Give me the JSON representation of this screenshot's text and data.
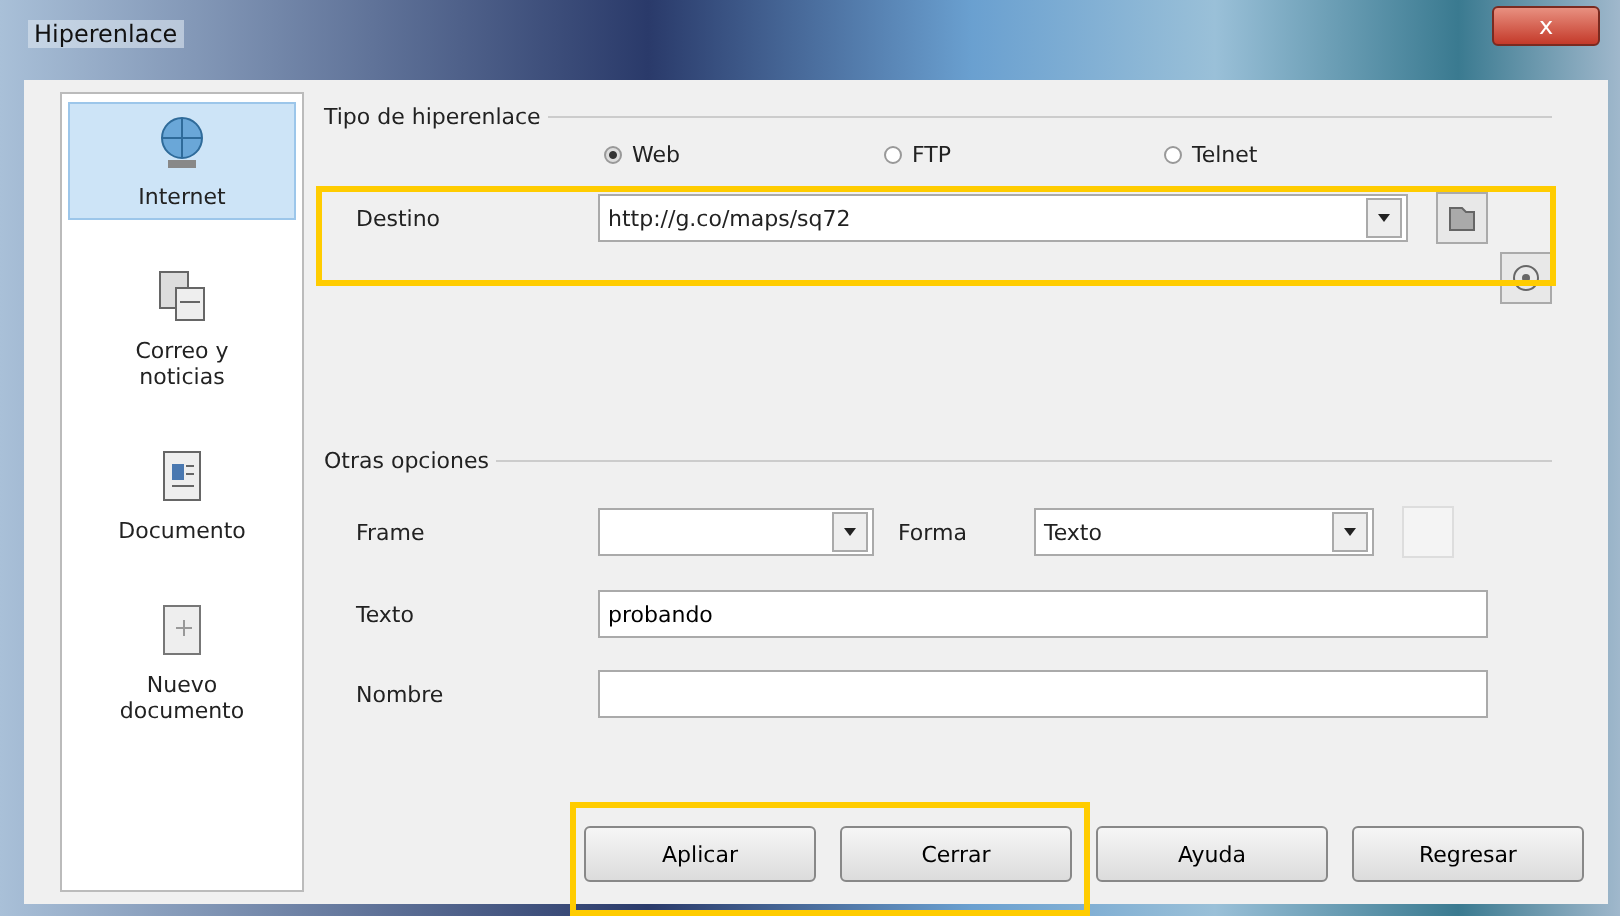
{
  "window": {
    "title": "Hiperenlace",
    "close": "x"
  },
  "sidebar": {
    "items": [
      {
        "label": "Internet",
        "selected": true,
        "kind": "globe"
      },
      {
        "label": "Correo y noticias",
        "selected": false,
        "kind": "mail"
      },
      {
        "label": "Documento",
        "selected": false,
        "kind": "doc"
      },
      {
        "label": "Nuevo documento",
        "selected": false,
        "kind": "newdoc"
      }
    ]
  },
  "hyperlink_type": {
    "legend": "Tipo de hiperenlace",
    "options": [
      {
        "label": "Web",
        "selected": true
      },
      {
        "label": "FTP",
        "selected": false
      },
      {
        "label": "Telnet",
        "selected": false
      }
    ]
  },
  "target": {
    "label": "Destino",
    "value": "http://g.co/maps/sq72"
  },
  "other_options": {
    "legend": "Otras opciones",
    "frame": {
      "label": "Frame"
    },
    "form": {
      "label": "Forma",
      "value": "Texto"
    },
    "text": {
      "label": "Texto",
      "value": "probando"
    },
    "name": {
      "label": "Nombre"
    }
  },
  "buttons": [
    "Aplicar",
    "Cerrar",
    "Ayuda",
    "Regresar"
  ]
}
